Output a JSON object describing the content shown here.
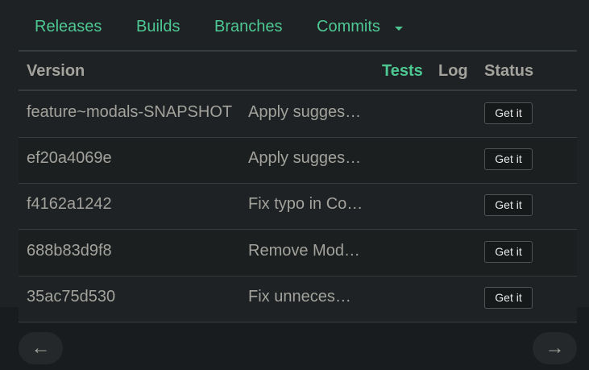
{
  "tabs": [
    {
      "label": "Releases"
    },
    {
      "label": "Builds"
    },
    {
      "label": "Branches"
    },
    {
      "label": "Commits"
    }
  ],
  "icons": {
    "dropdown": "caret-down-icon",
    "prev": "arrow-left-icon",
    "next": "arrow-right-icon"
  },
  "table": {
    "headers": {
      "version": "Version",
      "tests": "Tests",
      "log": "Log",
      "status": "Status"
    },
    "rows": [
      {
        "version": "feature~modals-SNAPSHOT",
        "message": "Apply sugges…",
        "action": "Get it"
      },
      {
        "version": "ef20a4069e",
        "message": "Apply sugges…",
        "action": "Get it"
      },
      {
        "version": "f4162a1242",
        "message": "Fix typo in Co…",
        "action": "Get it"
      },
      {
        "version": "688b83d9f8",
        "message": "Remove Mod…",
        "action": "Get it"
      },
      {
        "version": "35ac75d530",
        "message": "Fix unneces…",
        "action": "Get it"
      }
    ]
  },
  "pagination": {
    "prev": "←",
    "next": "→"
  },
  "colors": {
    "accent": "#4ec893",
    "background": "#1e2224",
    "text": "#a3a29c"
  }
}
